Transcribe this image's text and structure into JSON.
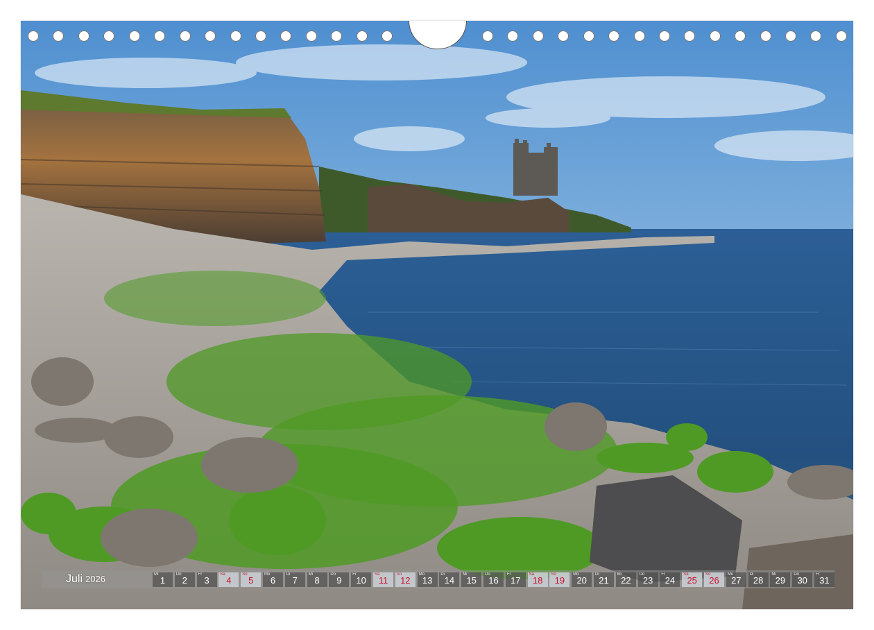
{
  "calendar": {
    "month": "Juli",
    "year": "2026",
    "days": [
      {
        "wd": "Mi",
        "n": "1",
        "sun": false
      },
      {
        "wd": "Do",
        "n": "2",
        "sun": false
      },
      {
        "wd": "Fr",
        "n": "3",
        "sun": false
      },
      {
        "wd": "Sa",
        "n": "4",
        "sun": true
      },
      {
        "wd": "So",
        "n": "5",
        "sun": true
      },
      {
        "wd": "Mo",
        "n": "6",
        "sun": false
      },
      {
        "wd": "Di",
        "n": "7",
        "sun": false
      },
      {
        "wd": "Mi",
        "n": "8",
        "sun": false
      },
      {
        "wd": "Do",
        "n": "9",
        "sun": false
      },
      {
        "wd": "Fr",
        "n": "10",
        "sun": false
      },
      {
        "wd": "Sa",
        "n": "11",
        "sun": true
      },
      {
        "wd": "So",
        "n": "12",
        "sun": true
      },
      {
        "wd": "Mo",
        "n": "13",
        "sun": false
      },
      {
        "wd": "Di",
        "n": "14",
        "sun": false
      },
      {
        "wd": "Mi",
        "n": "15",
        "sun": false
      },
      {
        "wd": "Do",
        "n": "16",
        "sun": false
      },
      {
        "wd": "Fr",
        "n": "17",
        "sun": false
      },
      {
        "wd": "Sa",
        "n": "18",
        "sun": true
      },
      {
        "wd": "So",
        "n": "19",
        "sun": true
      },
      {
        "wd": "Mo",
        "n": "20",
        "sun": false
      },
      {
        "wd": "Di",
        "n": "21",
        "sun": false
      },
      {
        "wd": "Mi",
        "n": "22",
        "sun": false
      },
      {
        "wd": "Do",
        "n": "23",
        "sun": false
      },
      {
        "wd": "Fr",
        "n": "24",
        "sun": false
      },
      {
        "wd": "Sa",
        "n": "25",
        "sun": true
      },
      {
        "wd": "So",
        "n": "26",
        "sun": true
      },
      {
        "wd": "Mo",
        "n": "27",
        "sun": false
      },
      {
        "wd": "Di",
        "n": "28",
        "sun": false
      },
      {
        "wd": "Mi",
        "n": "29",
        "sun": false
      },
      {
        "wd": "Do",
        "n": "30",
        "sun": false
      },
      {
        "wd": "Fr",
        "n": "31",
        "sun": false
      }
    ]
  },
  "colors": {
    "weekend_text": "#c8102e",
    "sea": "#1f4f86",
    "moss": "#5aa82a",
    "sky": "#8cb9e0"
  }
}
